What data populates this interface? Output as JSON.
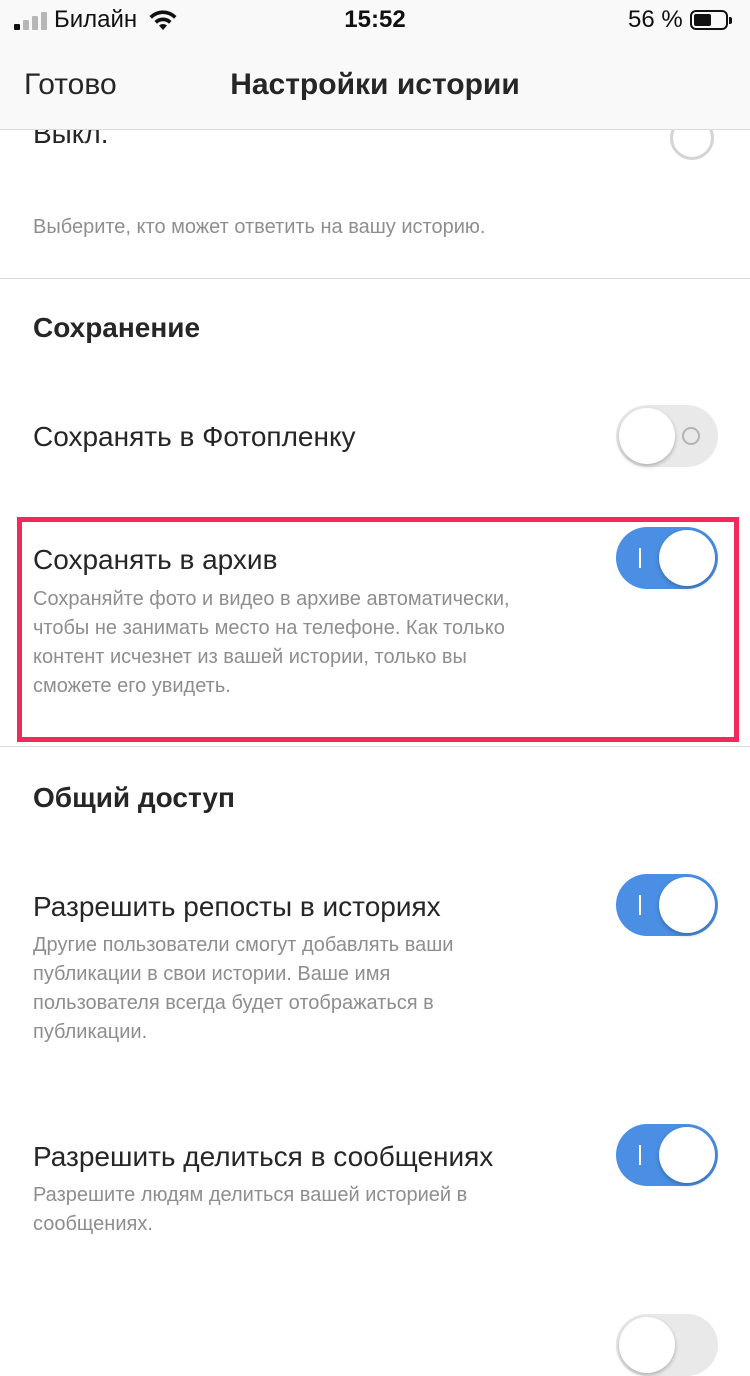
{
  "status_bar": {
    "carrier": "Билайн",
    "time": "15:52",
    "battery_percent": "56 %",
    "battery_level": 0.56
  },
  "nav": {
    "done_label": "Готово",
    "title": "Настройки истории"
  },
  "replies": {
    "off_label": "Выкл.",
    "off_selected": false,
    "description": "Выберите, кто может ответить на вашу историю."
  },
  "saving": {
    "section_title": "Сохранение",
    "save_to_camera_roll": {
      "label": "Сохранять в Фотопленку",
      "enabled": false
    },
    "save_to_archive": {
      "label": "Сохранять в архив",
      "enabled": true,
      "description_lines": [
        "Сохраняйте фото и видео в архиве автоматически,",
        "чтобы не занимать место на телефоне. Как только",
        "контент исчезнет из вашей истории, только вы",
        "сможете его увидеть."
      ]
    }
  },
  "sharing": {
    "section_title": "Общий доступ",
    "allow_resharing": {
      "label": "Разрешить репосты в историях",
      "enabled": true,
      "description_lines": [
        "Другие пользователи смогут добавлять ваши",
        "публикации в свои истории. Ваше имя",
        "пользователя всегда будет отображаться в",
        "публикации."
      ]
    },
    "allow_message_sharing": {
      "label": "Разрешить делиться в сообщениях",
      "enabled": true,
      "description_lines": [
        "Разрешите людям делиться вашей историей в",
        "сообщениях."
      ]
    }
  },
  "colors": {
    "toggle_on": "#4a8fe4",
    "highlight_border": "#f2295b"
  }
}
